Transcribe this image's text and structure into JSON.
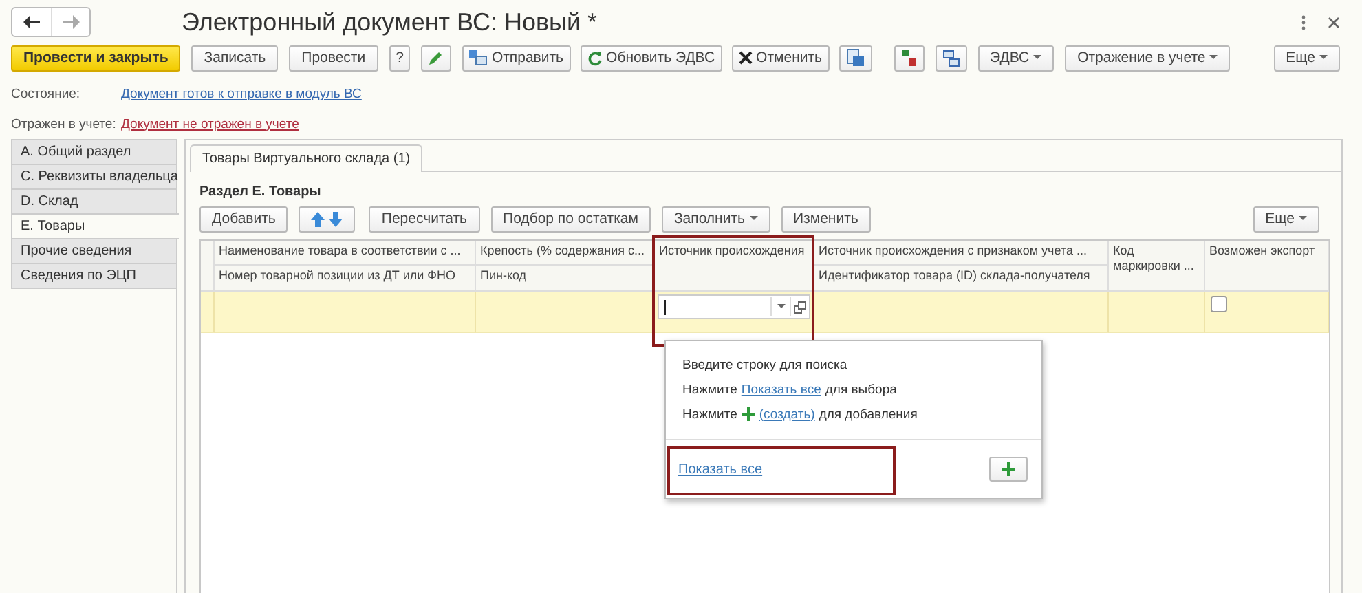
{
  "window": {
    "title": "Электронный документ ВС: Новый *"
  },
  "toolbar": [
    {
      "kind": "primary",
      "label": "Провести и закрыть"
    },
    {
      "kind": "plain",
      "label": "Записать"
    },
    {
      "kind": "plain",
      "label": "Провести"
    },
    {
      "kind": "plain",
      "label": "?"
    },
    {
      "kind": "edit"
    },
    {
      "kind": "send",
      "label": "Отправить"
    },
    {
      "kind": "refresh",
      "label": "Обновить ЭДВС"
    },
    {
      "kind": "cancel",
      "label": "Отменить"
    },
    {
      "kind": "report"
    },
    {
      "kind": "ledger"
    },
    {
      "kind": "structure"
    },
    {
      "kind": "menu",
      "label": "ЭДВС"
    },
    {
      "kind": "menu",
      "label": "Отражение в учете"
    }
  ],
  "more_button": "Еще",
  "status": [
    {
      "label": "Состояние:",
      "value": "Документ готов к отправке в модуль ВС",
      "warning": false
    },
    {
      "label": "Отражен в учете:",
      "value": "Документ не отражен в учете",
      "warning": true
    }
  ],
  "sidebar": {
    "items": [
      {
        "label": "A. Общий раздел",
        "selected": false
      },
      {
        "label": "C. Реквизиты владельца",
        "selected": false
      },
      {
        "label": "D. Склад",
        "selected": false
      },
      {
        "label": "E. Товары",
        "selected": true
      },
      {
        "label": "Прочие сведения",
        "selected": false
      },
      {
        "label": "Сведения по ЭЦП",
        "selected": false
      }
    ]
  },
  "tabs": [
    {
      "label": "Товары Виртуального склада (1)",
      "selected": true
    }
  ],
  "section_title": "Раздел E. Товары",
  "table_toolbar": [
    {
      "kind": "plain",
      "label": "Добавить"
    },
    {
      "kind": "arrows"
    },
    {
      "kind": "plain",
      "label": "Пересчитать"
    },
    {
      "kind": "plain",
      "label": "Подбор по остаткам"
    },
    {
      "kind": "menu",
      "label": "Заполнить"
    },
    {
      "kind": "plain",
      "label": "Изменить"
    }
  ],
  "table_more_button": "Еще",
  "table": {
    "columns": [
      {
        "top": "Наименование товара в соответствии с ...",
        "bottom": "Номер товарной позиции из ДТ или ФНО"
      },
      {
        "top": "Крепость (% содержания с...",
        "bottom": "Пин-код"
      },
      {
        "top": "Источник происхождения"
      },
      {
        "top": "Источник происхождения с признаком учета ...",
        "bottom": "Идентификатор товара (ID) склада-получателя"
      },
      {
        "top": "Код маркировки ..."
      },
      {
        "top": "Возможен экспорт"
      }
    ],
    "rows": [
      {
        "selected": true,
        "export_checked": false
      }
    ]
  },
  "dropdown": {
    "lines": [
      {
        "kind": "text",
        "before": "Введите строку для поиска"
      },
      {
        "kind": "link",
        "before": "Нажмите",
        "link": "Показать все",
        "after": "для выбора"
      },
      {
        "kind": "create",
        "before": "Нажмите",
        "link": "(создать)",
        "after": "для добавления"
      }
    ],
    "show_all": "Показать все"
  }
}
